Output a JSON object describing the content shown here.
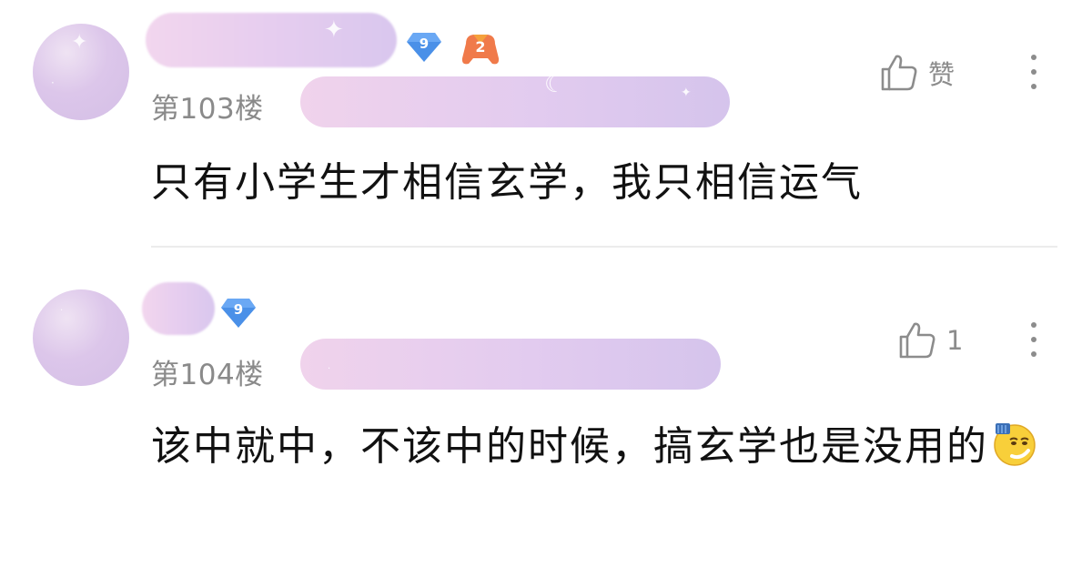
{
  "comments": [
    {
      "floor": "第103楼",
      "level": "9",
      "medal": "2",
      "like_label": "赞",
      "text": "只有小学生才相信玄学，我只相信运气"
    },
    {
      "floor": "第104楼",
      "level": "9",
      "like_label": "1",
      "text": "该中就中，不该中的时候，搞玄学也是没用的"
    }
  ],
  "icons": {
    "like": "thumbs-up-icon",
    "more": "more-vertical-icon",
    "level": "diamond-level-icon",
    "medal": "game-medal-icon",
    "emoji": "smirk-emoji-icon"
  },
  "colors": {
    "level_badge": "#4a90e8",
    "medal_badge": "#f07a4a",
    "meta_text": "#8a8a8a",
    "content_text": "#111111"
  }
}
